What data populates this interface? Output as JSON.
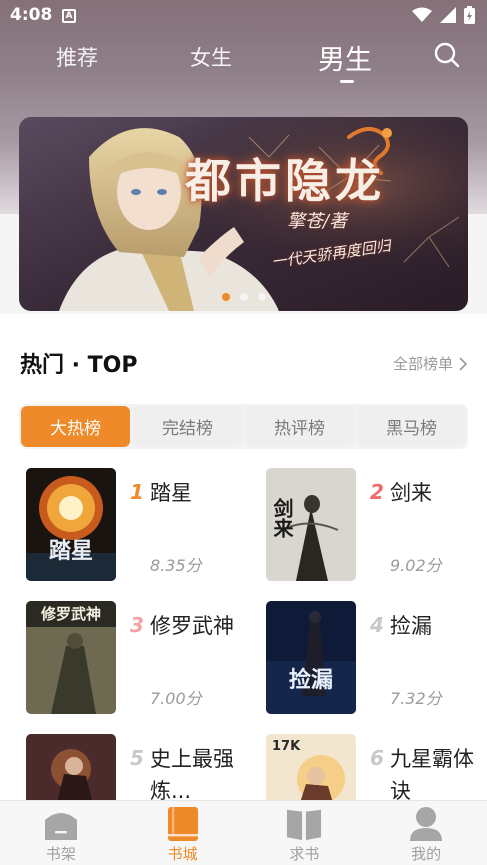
{
  "status_bar": {
    "time": "4:08",
    "indicator": "A"
  },
  "top_nav": {
    "tabs": [
      {
        "label": "推荐",
        "active": false
      },
      {
        "label": "女生",
        "active": false
      },
      {
        "label": "男生",
        "active": true
      }
    ],
    "search_icon": "search-icon"
  },
  "banner": {
    "title": "都市隐龙",
    "author": "擎苍/著",
    "slogan": "一代天骄再度回归",
    "dots": 3,
    "active_dot": 0
  },
  "section": {
    "title": "热门 · TOP",
    "more": "全部榜单"
  },
  "rank_tabs": [
    {
      "label": "大热榜",
      "active": true
    },
    {
      "label": "完结榜",
      "active": false
    },
    {
      "label": "热评榜",
      "active": false
    },
    {
      "label": "黑马榜",
      "active": false
    }
  ],
  "books": [
    {
      "rank": "1",
      "title": "踏星",
      "score": "8.35分",
      "cover_text": "踏星",
      "rank_color": "#ef8a2a"
    },
    {
      "rank": "2",
      "title": "剑来",
      "score": "9.02分",
      "cover_text": "剑来",
      "rank_color": "#f06a6a"
    },
    {
      "rank": "3",
      "title": "修罗武神",
      "score": "7.00分",
      "cover_text": "修罗武神",
      "rank_color": "#f3a3a3"
    },
    {
      "rank": "4",
      "title": "捡漏",
      "score": "7.32分",
      "cover_text": "捡漏",
      "rank_color": "#c8c8c8"
    },
    {
      "rank": "5",
      "title": "史上最强炼...",
      "score": "",
      "cover_text": "",
      "rank_color": "#c8c8c8"
    },
    {
      "rank": "6",
      "title": "九星霸体诀",
      "score": "",
      "cover_text": "17K",
      "rank_color": "#c8c8c8"
    }
  ],
  "tab_bar": [
    {
      "label": "书架",
      "icon": "bookshelf-icon",
      "active": false
    },
    {
      "label": "书城",
      "icon": "bookstore-icon",
      "active": true
    },
    {
      "label": "求书",
      "icon": "open-book-icon",
      "active": false
    },
    {
      "label": "我的",
      "icon": "profile-icon",
      "active": false
    }
  ]
}
